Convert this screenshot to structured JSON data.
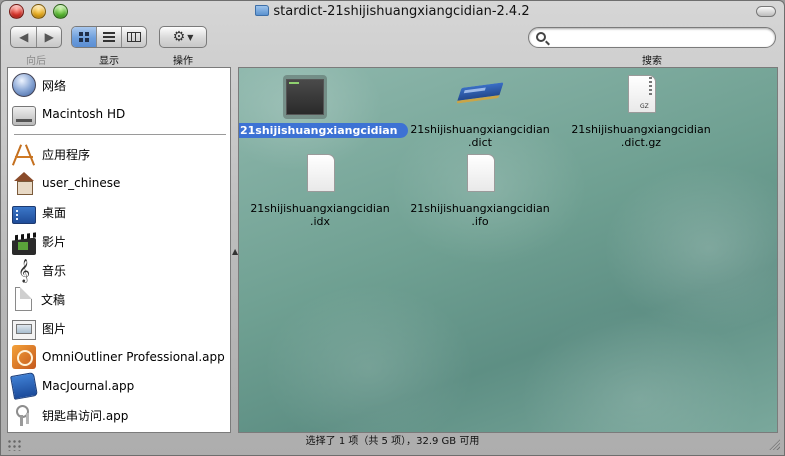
{
  "window": {
    "title": "stardict-21shijishuangxiangcidian-2.4.2"
  },
  "toolbar": {
    "back_forward_label": "向后",
    "view_label": "显示",
    "action_label": "操作",
    "search_label": "搜索",
    "search_value": "",
    "search_placeholder": ""
  },
  "sidebar": {
    "devices": [
      {
        "label": "网络",
        "icon": "network-icon"
      },
      {
        "label": "Macintosh HD",
        "icon": "hard-disk-icon"
      }
    ],
    "places": [
      {
        "label": "应用程序",
        "icon": "applications-icon"
      },
      {
        "label": "user_chinese",
        "icon": "home-icon"
      },
      {
        "label": "桌面",
        "icon": "desktop-icon"
      },
      {
        "label": "影片",
        "icon": "movies-icon"
      },
      {
        "label": "音乐",
        "icon": "music-icon"
      },
      {
        "label": "文稿",
        "icon": "documents-icon"
      },
      {
        "label": "图片",
        "icon": "pictures-icon"
      },
      {
        "label": "OmniOutliner Professional.app",
        "icon": "omnioutliner-icon"
      },
      {
        "label": "MacJournal.app",
        "icon": "macjournal-icon"
      },
      {
        "label": "钥匙串访问.app",
        "icon": "keychain-icon"
      }
    ]
  },
  "files": [
    {
      "name": "21shijishuangxiangcidian",
      "selected": true,
      "icon": "terminal-file-icon"
    },
    {
      "name": "21shijishuangxiangcidian\n.dict",
      "selected": false,
      "icon": "dictionary-book-icon"
    },
    {
      "name": "21shijishuangxiangcidian\n.dict.gz",
      "selected": false,
      "icon": "gzip-archive-icon"
    },
    {
      "name": "21shijishuangxiangcidian\n.idx",
      "selected": false,
      "icon": "document-icon"
    },
    {
      "name": "21shijishuangxiangcidian\n.ifo",
      "selected": false,
      "icon": "document-icon"
    }
  ],
  "gz_label": "GZ",
  "status": {
    "text": "选择了 1 项（共 5 项），32.9 GB 可用"
  },
  "colors": {
    "selection": "#3d72d4",
    "accent": "#6e9fdc",
    "content_bg": "#6fa092"
  }
}
